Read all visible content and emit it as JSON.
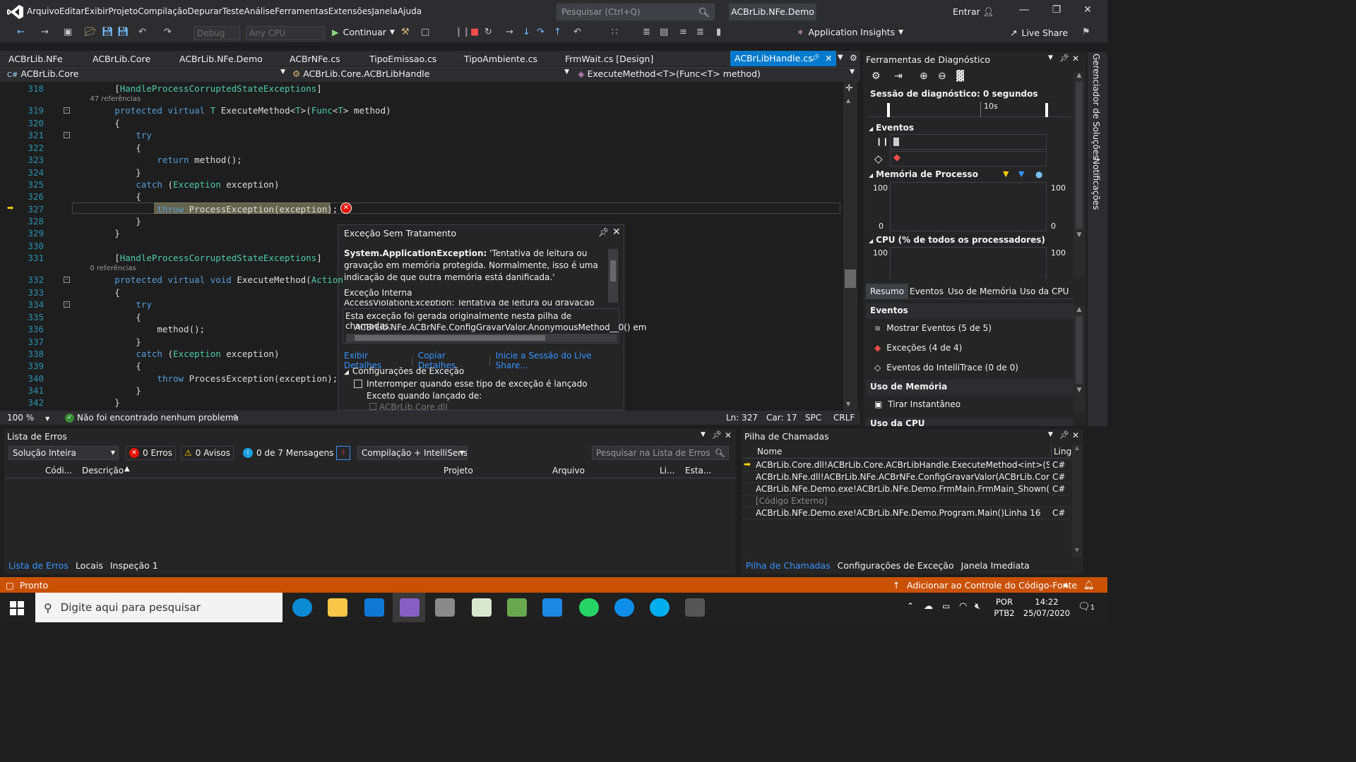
{
  "menu": [
    "Arquivo",
    "Editar",
    "Exibir",
    "Projeto",
    "Compilação",
    "Depurar",
    "Teste",
    "Análise",
    "Ferramentas",
    "Extensões",
    "Janela",
    "Ajuda"
  ],
  "search_placeholder": "Pesquisar (Ctrl+Q)",
  "solution_name": "ACBrLib.NFe.Demo",
  "entrar": "Entrar",
  "toolbar": {
    "config": "Debug",
    "platform": "Any CPU",
    "continue": "Continuar",
    "app_insights": "Application Insights",
    "live_share": "Live Share"
  },
  "tabs": [
    "ACBrLib.NFe",
    "ACBrLib.Core",
    "ACBrLib.NFe.Demo",
    "ACBrNFe.cs",
    "TipoEmissao.cs",
    "TipoAmbiente.cs",
    "FrmWait.cs [Design]"
  ],
  "active_tab": "ACBrLibHandle.cs",
  "nav": {
    "project": "ACBrLib.Core",
    "class": "ACBrLib.Core.ACBrLibHandle",
    "member": "ExecuteMethod<T>(Func<T> method)"
  },
  "code": [
    {
      "n": "318",
      "t": "        [HandleProcessCorruptedStateExceptions]"
    },
    {
      "n": "",
      "t": "        47 referências"
    },
    {
      "n": "319",
      "t": "        protected virtual T ExecuteMethod<T>(Func<T> method)"
    },
    {
      "n": "320",
      "t": "        {"
    },
    {
      "n": "321",
      "t": "            try"
    },
    {
      "n": "322",
      "t": "            {"
    },
    {
      "n": "323",
      "t": "                return method();"
    },
    {
      "n": "324",
      "t": "            }"
    },
    {
      "n": "325",
      "t": "            catch (Exception exception)"
    },
    {
      "n": "326",
      "t": "            {"
    },
    {
      "n": "327",
      "t": "                throw ProcessException(exception);"
    },
    {
      "n": "328",
      "t": "            }"
    },
    {
      "n": "329",
      "t": "        }"
    },
    {
      "n": "330",
      "t": ""
    },
    {
      "n": "331",
      "t": "        [HandleProcessCorruptedStateExceptions]"
    },
    {
      "n": "",
      "t": "        0 referências"
    },
    {
      "n": "332",
      "t": "        protected virtual void ExecuteMethod(Action"
    },
    {
      "n": "333",
      "t": "        {"
    },
    {
      "n": "334",
      "t": "            try"
    },
    {
      "n": "335",
      "t": "            {"
    },
    {
      "n": "336",
      "t": "                method();"
    },
    {
      "n": "337",
      "t": "            }"
    },
    {
      "n": "338",
      "t": "            catch (Exception exception)"
    },
    {
      "n": "339",
      "t": "            {"
    },
    {
      "n": "340",
      "t": "                throw ProcessException(exception);"
    },
    {
      "n": "341",
      "t": "            }"
    },
    {
      "n": "342",
      "t": "        }"
    }
  ],
  "exception": {
    "title": "Exceção Sem Tratamento",
    "type": "System.ApplicationException:",
    "msg": "'Tentativa de leitura ou gravação em memória protegida. Normalmente, isso é uma indicação de que outra memória está danificada.'",
    "inner_label": "Exceção Interna",
    "inner": "AccessViolationException: Tentativa de leitura ou gravação em",
    "stack_label": "Esta exceção foi gerada originalmente nesta pilha de chamadas:",
    "stack_line": "ACBrLib.NFe.ACBrNFe.ConfigGravarValor.AnonymousMethod__0() em",
    "links": [
      "Exibir Detalhes",
      "Copiar Detalhes",
      "Inicie a Sessão do Live Share..."
    ],
    "config_label": "Configurações de Exceção",
    "checkbox_label": "Interromper quando esse tipo de exceção é lançado",
    "except_label": "Exceto quando lançado de:",
    "except_item": "ACBrLib.Core.dll"
  },
  "editor_status": {
    "zoom": "100 %",
    "problems": "Não foi encontrado nenhum problema",
    "ln": "Ln: 327",
    "car": "Car: 17",
    "spc": "SPC",
    "crlf": "CRLF"
  },
  "errors": {
    "title": "Lista de Erros",
    "scope": "Solução Inteira",
    "errors": "0 Erros",
    "warnings": "0 Avisos",
    "messages": "0 de 7 Mensagens",
    "build": "Compilação + IntelliSens",
    "search": "Pesquisar na Lista de Erros",
    "cols": [
      "Códi...",
      "Descrição",
      "Projeto",
      "Arquivo",
      "Li...",
      "Esta..."
    ],
    "tabs": [
      "Lista de Erros",
      "Locais",
      "Inspeção 1"
    ]
  },
  "diag": {
    "title": "Ferramentas de Diagnóstico",
    "session": "Sessão de diagnóstico: 0 segundos",
    "time_label": "10s",
    "events": "Eventos",
    "memory": "Memória de Processo",
    "cpu": "CPU (% de todos os processadores)",
    "y100": "100",
    "y0": "0",
    "tabs": [
      "Resumo",
      "Eventos",
      "Uso de Memória",
      "Uso da CPU"
    ],
    "section_events": "Eventos",
    "items": [
      "Mostrar Eventos (5 de 5)",
      "Exceções (4 de 4)",
      "Eventos do IntelliTrace (0 de 0)"
    ],
    "section_mem": "Uso de Memória",
    "snapshot": "Tirar Instantâneo",
    "cut": "Uso da CPU"
  },
  "callstack": {
    "title": "Pilha de Chamadas",
    "col_name": "Nome",
    "col_lang": "Lingu",
    "rows": [
      {
        "name": "ACBrLib.Core.dll!ACBrLib.Core.ACBrLibHandle.ExecuteMethod<int>(System....",
        "lang": "C#"
      },
      {
        "name": "ACBrLib.NFe.dll!ACBrLib.NFe.ACBrNFe.ConfigGravarValor(ACBrLib.Core.ACB...",
        "lang": "C#"
      },
      {
        "name": "ACBrLib.NFe.Demo.exe!ACBrLib.NFe.Demo.FrmMain.FrmMain_Shown(objec...",
        "lang": "C#"
      },
      {
        "name": "[Código Externo]",
        "lang": ""
      },
      {
        "name": "ACBrLib.NFe.Demo.exe!ACBrLib.NFe.Demo.Program.Main()Linha 16",
        "lang": "C#"
      }
    ],
    "tabs": [
      "Pilha de Chamadas",
      "Configurações de Exceção",
      "Janela Imediata"
    ]
  },
  "side": [
    "Gerenciador de Soluções",
    "Notificações"
  ],
  "status": {
    "ready": "Pronto",
    "source": "Adicionar ao Controle do Código-Fonte"
  },
  "taskbar": {
    "search": "Digite aqui para pesquisar",
    "lang": "POR",
    "layout": "PTB2",
    "time": "14:22",
    "date": "25/07/2020",
    "notif": "1"
  }
}
